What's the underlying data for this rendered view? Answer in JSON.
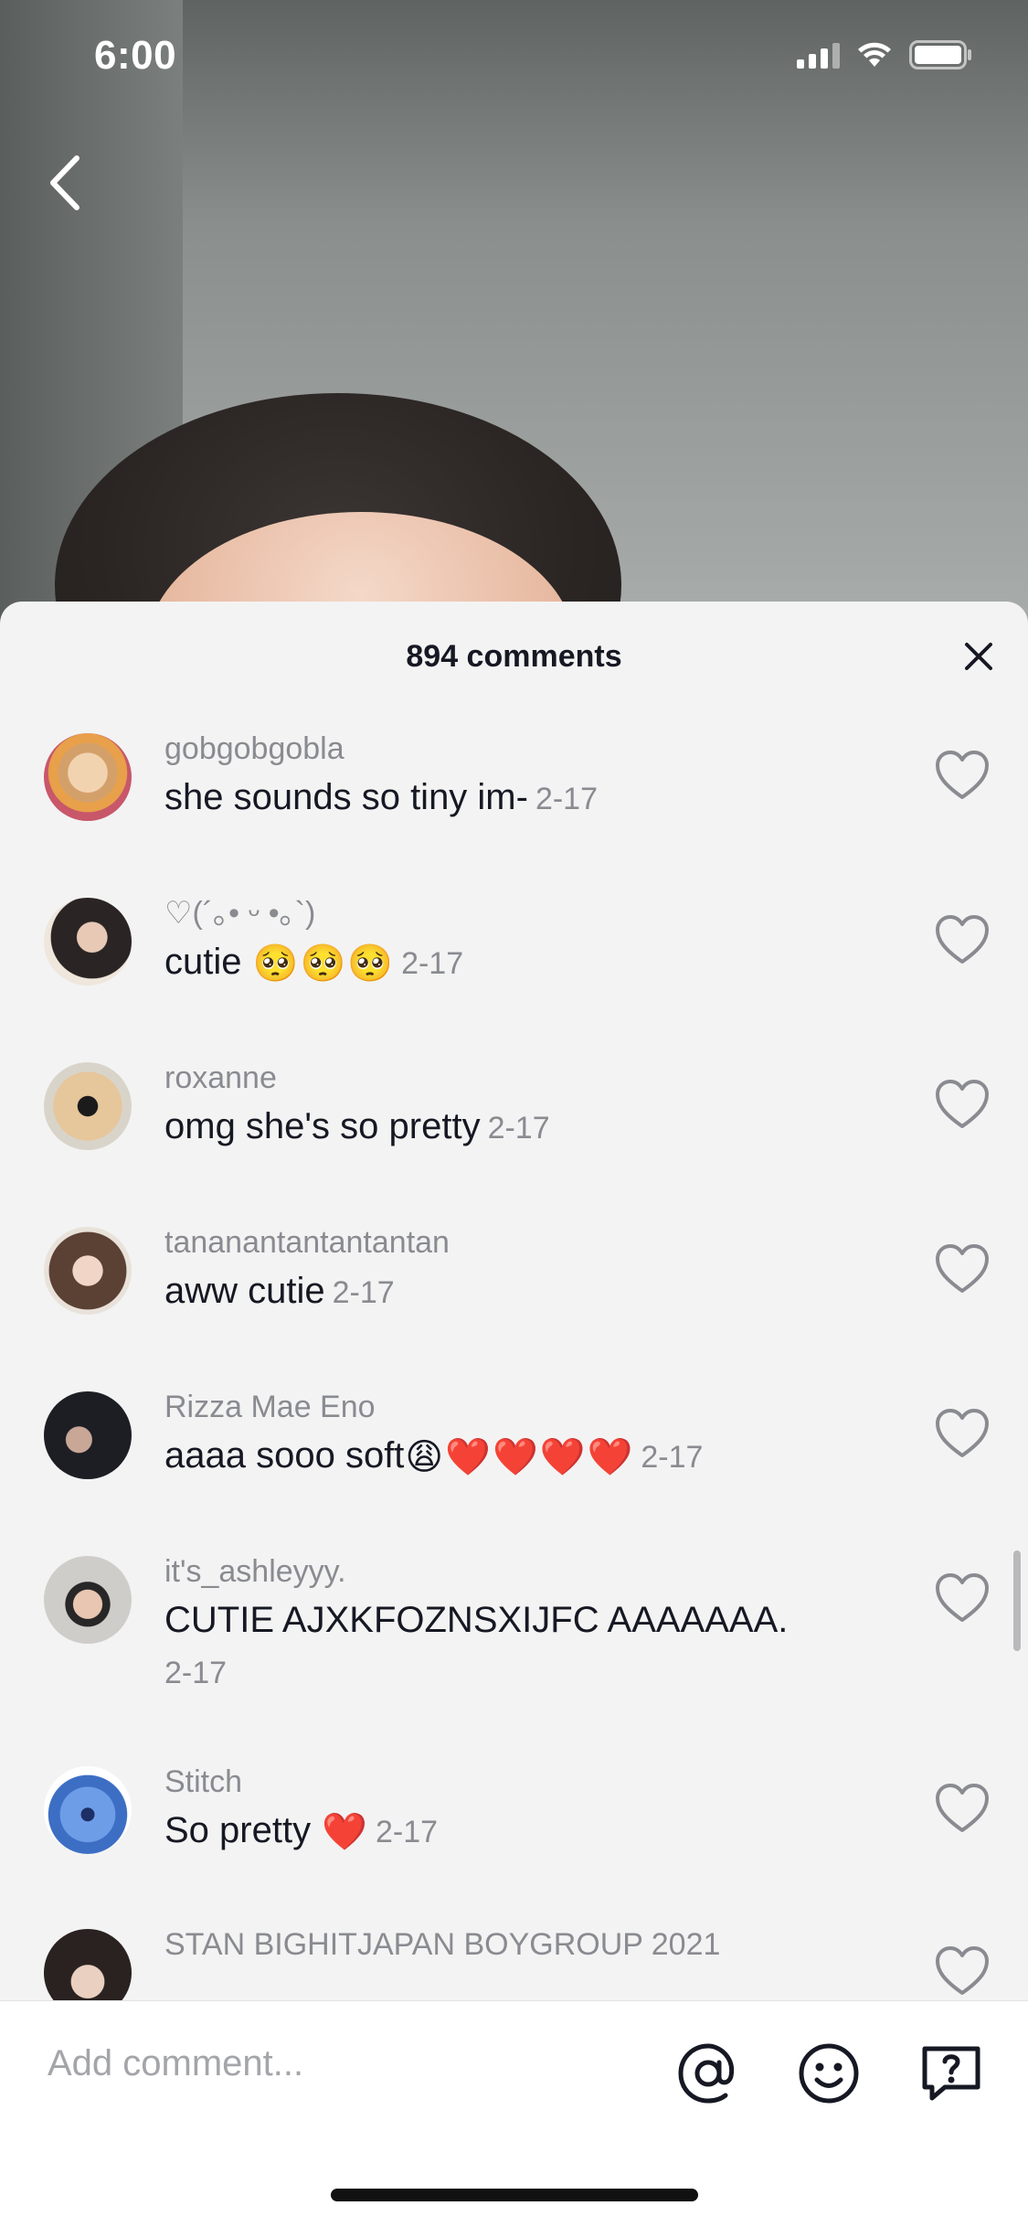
{
  "status_bar": {
    "time": "6:00"
  },
  "sheet": {
    "title": "894 comments"
  },
  "comments": [
    {
      "username": "gobgobgobla",
      "text": "she sounds so tiny im-",
      "emojis": [],
      "time": "2-17"
    },
    {
      "username": "♡(´｡• ᵕ •｡`)",
      "text": "cutie",
      "emojis": [
        "🥺",
        "🥺",
        "🥺"
      ],
      "time": "2-17"
    },
    {
      "username": "roxanne",
      "text": "omg she's so pretty",
      "emojis": [],
      "time": "2-17"
    },
    {
      "username": "tananantantantantan",
      "text": "aww cutie",
      "emojis": [],
      "time": "2-17"
    },
    {
      "username": "Rizza Mae Eno",
      "text": "aaaa sooo soft",
      "emojis": [
        "😩",
        "❤️",
        "❤️",
        "❤️",
        "❤️"
      ],
      "time": "2-17"
    },
    {
      "username": "it's_ashleyyy.",
      "text": "CUTIE AJXKFOZNSXIJFC AAAAAAA.",
      "emojis": [],
      "time": "2-17"
    },
    {
      "username": "Stitch",
      "text": "So pretty",
      "emojis": [
        "❤️"
      ],
      "time": "2-17"
    },
    {
      "username": "STAN BIGHITJAPAN BOYGROUP 2021",
      "text": "",
      "emojis": [],
      "time": ""
    }
  ],
  "input": {
    "placeholder": "Add comment..."
  },
  "icons": {
    "back": "chevron-left-icon",
    "close": "close-icon",
    "like": "heart-outline-icon",
    "mention": "at-sign-icon",
    "emoji": "smiley-icon",
    "question": "question-bubble-icon"
  },
  "colors": {
    "sheet_bg": "#f3f3f3",
    "username": "#8a8b91",
    "text": "#161823"
  }
}
